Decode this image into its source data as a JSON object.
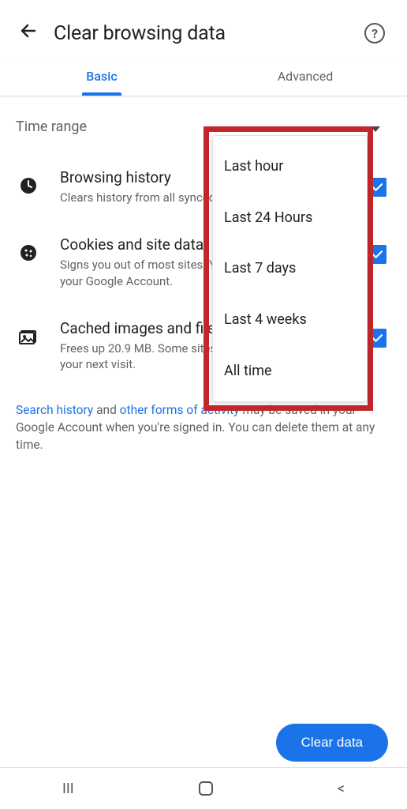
{
  "header": {
    "title": "Clear browsing data"
  },
  "tabs": {
    "basic": "Basic",
    "advanced": "Advanced"
  },
  "time_range": {
    "label": "Time range",
    "options": [
      "Last hour",
      "Last 24 Hours",
      "Last 7 days",
      "Last 4 weeks",
      "All time"
    ]
  },
  "settings": {
    "browsing": {
      "title": "Browsing history",
      "desc": "Clears history from all synced devices."
    },
    "cookies": {
      "title": "Cookies and site data",
      "desc": "Signs you out of most sites. You won't be signed out of your Google Account."
    },
    "cache": {
      "title": "Cached images and files",
      "desc": "Frees up 20.9 MB. Some sites may load more slowly on your next visit."
    }
  },
  "footnote": {
    "link1": "Search history",
    "mid1": " and ",
    "link2": "other forms of activity",
    "rest": " may be saved in your Google Account when you're signed in. You can delete them at any time."
  },
  "actions": {
    "clear": "Clear data"
  }
}
